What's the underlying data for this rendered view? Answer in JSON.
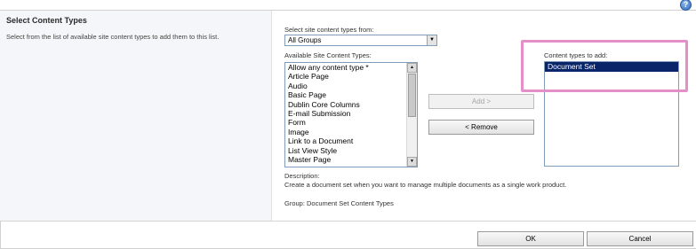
{
  "help_icon_glyph": "?",
  "section": {
    "title": "Select Content Types",
    "description": "Select from the list of available site content types to add them to this list."
  },
  "select_from": {
    "label": "Select site content types from:",
    "value": "All Groups"
  },
  "available": {
    "label": "Available Site Content Types:",
    "items": [
      "Allow any content type *",
      "Article Page",
      "Audio",
      "Basic Page",
      "Dublin Core Columns",
      "E-mail Submission",
      "Form",
      "Image",
      "Link to a Document",
      "List View Style",
      "Master Page"
    ]
  },
  "buttons": {
    "add": "Add >",
    "remove": "< Remove",
    "ok": "OK",
    "cancel": "Cancel"
  },
  "to_add": {
    "label": "Content types to add:",
    "items": [
      "Document Set"
    ],
    "selected": "Document Set"
  },
  "description": {
    "label": "Description:",
    "text": "Create a document set when you want to manage multiple documents as a single work product.",
    "group": "Group: Document Set Content Types"
  },
  "colors": {
    "selection": "#0a246a",
    "highlight": "#e48fc7",
    "left_panel_bg": "#f4f6f9"
  }
}
